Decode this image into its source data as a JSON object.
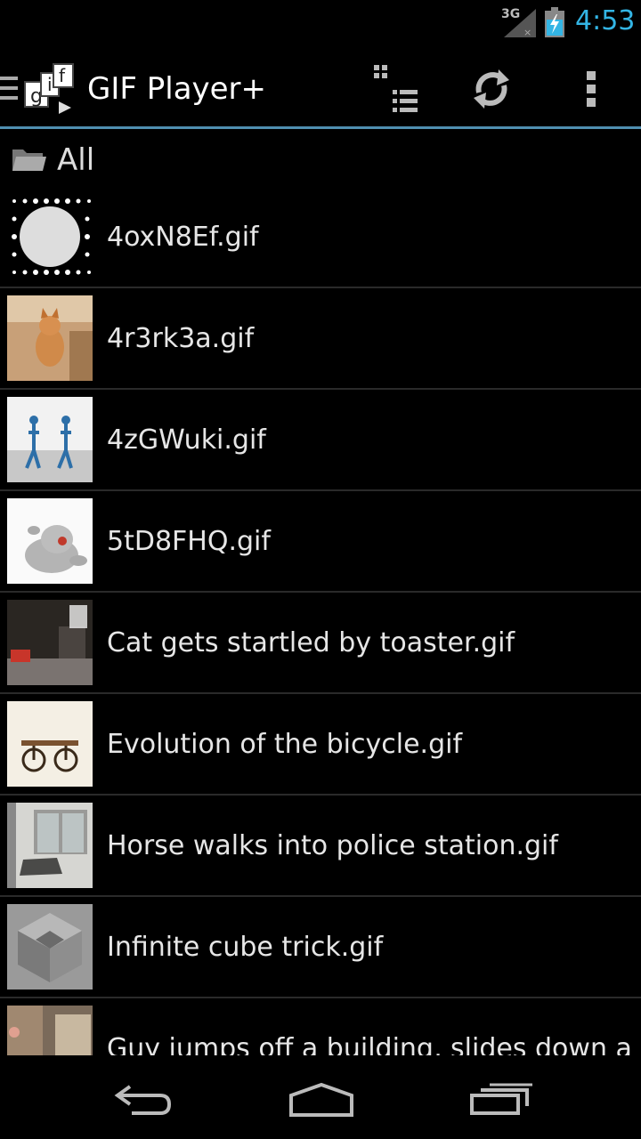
{
  "status_bar": {
    "network": "3G",
    "time": "4:53"
  },
  "app": {
    "title": "GIF Player+",
    "logo_letters": "gif",
    "accent": "#33b5e5"
  },
  "toolbar": {
    "view_toggle_icon": "grid-list-icon",
    "refresh_icon": "refresh-icon",
    "overflow_icon": "overflow-menu-icon"
  },
  "folder": {
    "label": "All"
  },
  "files": [
    {
      "name": "4oxN8Ef.gif",
      "thumb": "halftone-dots"
    },
    {
      "name": "4r3rk3a.gif",
      "thumb": "dog"
    },
    {
      "name": "4zGWuki.gif",
      "thumb": "robots"
    },
    {
      "name": "5tD8FHQ.gif",
      "thumb": "plush-toy"
    },
    {
      "name": "Cat gets startled by toaster.gif",
      "thumb": "kitchen"
    },
    {
      "name": "Evolution of the bicycle.gif",
      "thumb": "bicycle"
    },
    {
      "name": "Horse walks into police station.gif",
      "thumb": "lobby"
    },
    {
      "name": "Infinite cube trick.gif",
      "thumb": "cube"
    },
    {
      "name": "Guy jumps off a building, slides down a",
      "thumb": "building"
    }
  ],
  "navigation": {
    "back_icon": "back-icon",
    "home_icon": "home-icon",
    "recents_icon": "recent-apps-icon"
  }
}
